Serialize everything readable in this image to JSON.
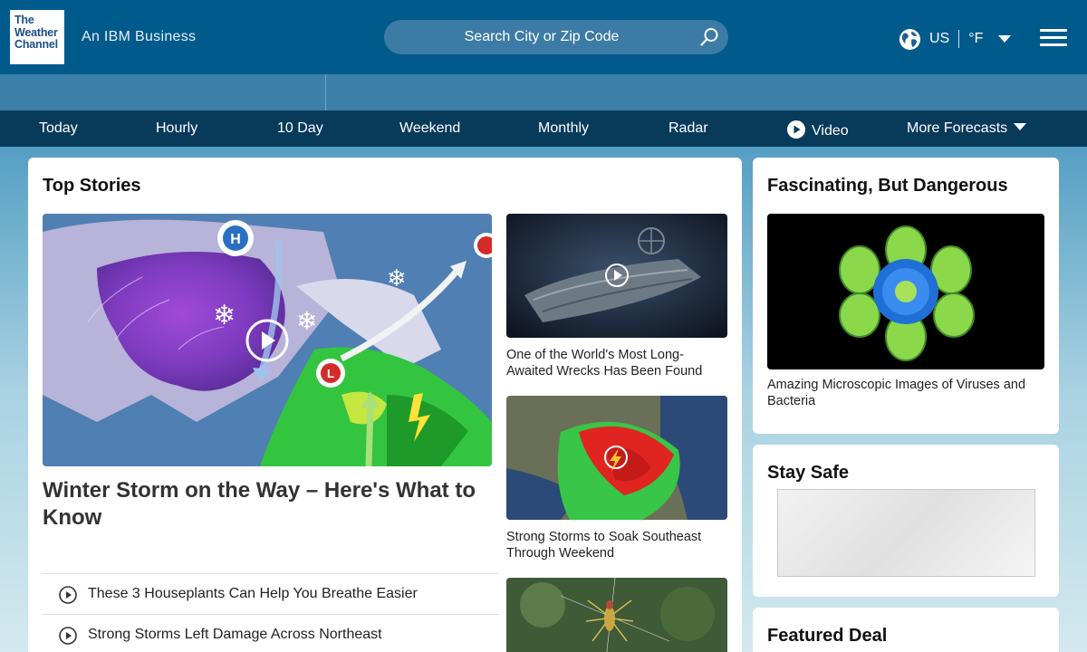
{
  "header": {
    "logo_lines": [
      "The",
      "Weather",
      "Channel"
    ],
    "tagline": "An IBM Business",
    "search_placeholder": "Search City or Zip Code",
    "country": "US",
    "unit": "°F"
  },
  "nav": {
    "items": [
      "Today",
      "Hourly",
      "10 Day",
      "Weekend",
      "Monthly",
      "Radar",
      "Video",
      "More Forecasts"
    ]
  },
  "top_stories": {
    "title": "Top Stories",
    "main_headline": "Winter Storm on the Way – Here's What to Know",
    "side": [
      {
        "caption": "One of the World's Most Long-Awaited Wrecks Has Been Found"
      },
      {
        "caption": "Strong Storms to Soak Southeast Through Weekend"
      }
    ],
    "list": [
      "These 3 Houseplants Can Help You Breathe Easier",
      "Strong Storms Left Damage Across Northeast"
    ]
  },
  "fascinating": {
    "title": "Fascinating, But Dangerous",
    "caption": "Amazing Microscopic Images of Viruses and Bacteria"
  },
  "stay_safe": {
    "title": "Stay Safe"
  },
  "featured_deal": {
    "title": "Featured Deal"
  },
  "colors": {
    "header_bg": "#005a8c",
    "nav_bg": "#083a5a",
    "search_bg": "#3c7ba5"
  }
}
